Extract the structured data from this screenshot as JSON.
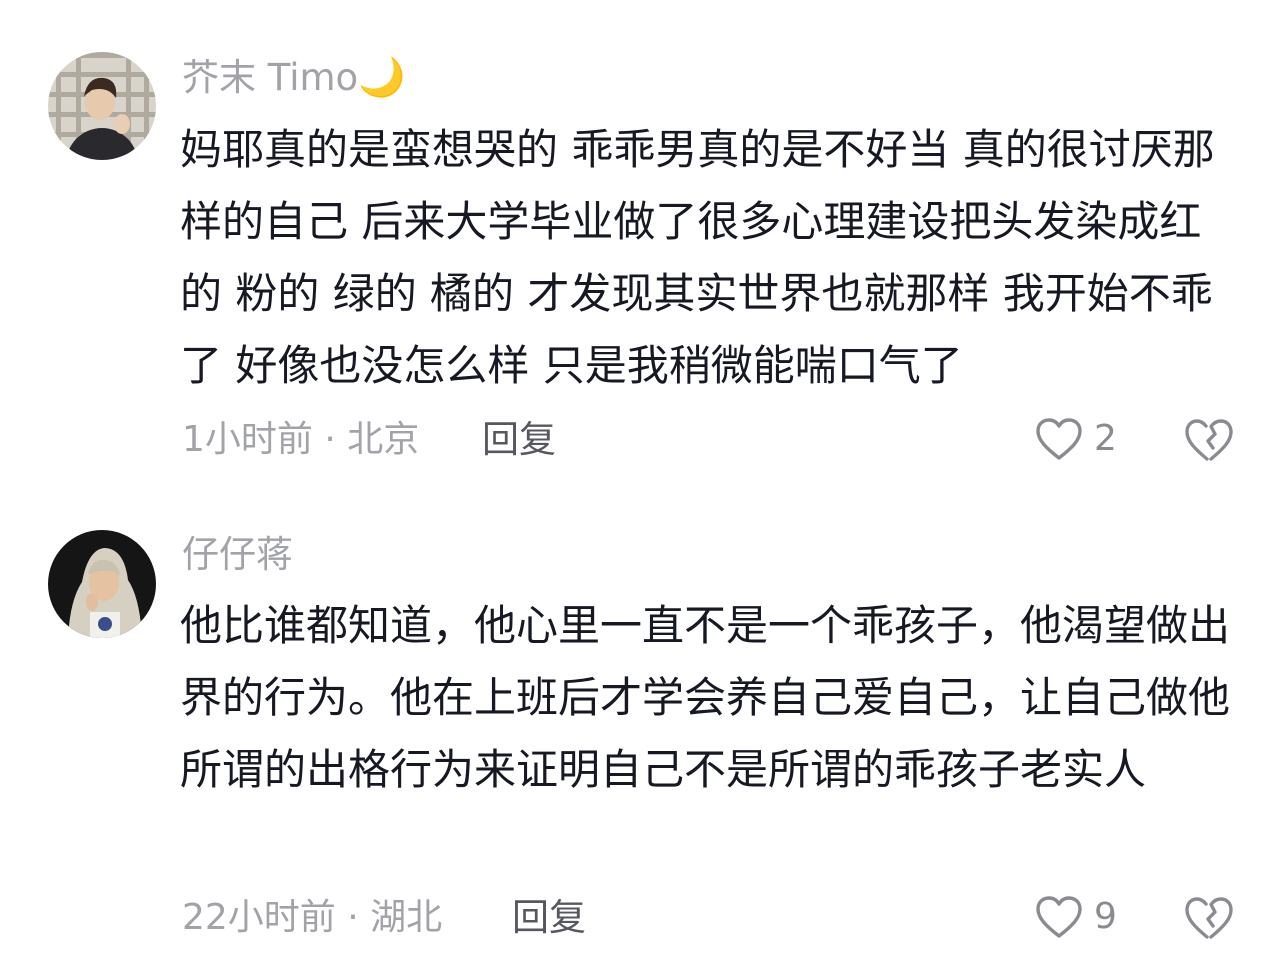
{
  "comments": [
    {
      "username": "芥末 Timo",
      "username_emoji": "🌙",
      "text": "妈耶真的是蛮想哭的 乖乖男真的是不好当 真的很讨厌那样的自己 后来大学毕业做了很多心理建设把头发染成红的 粉的 绿的 橘的 才发现其实世界也就那样 我开始不乖了 好像也没怎么样 只是我稍微能喘口气了",
      "time_location": "1小时前 · 北京",
      "reply_label": "回复",
      "like_count": "2"
    },
    {
      "username": "仔仔蒋",
      "text": "他比谁都知道，他心里一直不是一个乖孩子，他渴望做出界的行为。他在上班后才学会养自己爱自己，让自己做他所谓的出格行为来证明自己不是所谓的乖孩子老实人",
      "time_location": "22小时前 · 湖北",
      "reply_label": "回复",
      "like_count": "9"
    }
  ],
  "icons": {
    "like": "heart-outline-icon",
    "dislike": "broken-heart-icon"
  },
  "colors": {
    "username": "#a2a3a8",
    "body_text": "#161823",
    "meta": "#a2a3a8",
    "reply": "#57585f",
    "icon_stroke": "#8a8b91"
  }
}
